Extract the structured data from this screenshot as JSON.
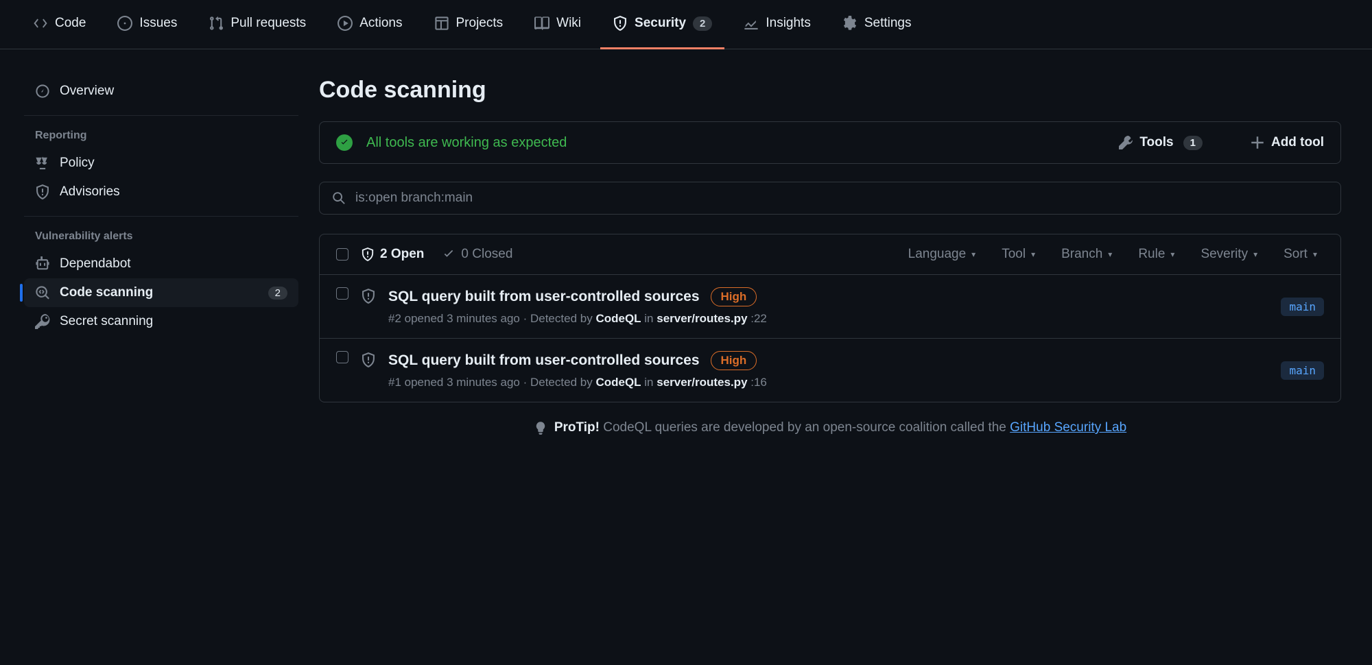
{
  "topnav": {
    "tabs": [
      {
        "label": "Code"
      },
      {
        "label": "Issues"
      },
      {
        "label": "Pull requests"
      },
      {
        "label": "Actions"
      },
      {
        "label": "Projects"
      },
      {
        "label": "Wiki"
      },
      {
        "label": "Security",
        "badge": "2",
        "active": true
      },
      {
        "label": "Insights"
      },
      {
        "label": "Settings"
      }
    ]
  },
  "sidebar": {
    "overview": "Overview",
    "section_reporting": "Reporting",
    "policy": "Policy",
    "advisories": "Advisories",
    "section_vuln": "Vulnerability alerts",
    "dependabot": "Dependabot",
    "code_scanning": "Code scanning",
    "code_scanning_count": "2",
    "secret_scanning": "Secret scanning"
  },
  "page": {
    "title": "Code scanning",
    "status_text": "All tools are working as expected",
    "tools_label": "Tools",
    "tools_count": "1",
    "add_tool": "Add tool"
  },
  "search": {
    "value": "is:open branch:main"
  },
  "listhead": {
    "open": "2 Open",
    "closed": "0 Closed",
    "filters": [
      "Language",
      "Tool",
      "Branch",
      "Rule",
      "Severity",
      "Sort"
    ]
  },
  "alerts": [
    {
      "title": "SQL query built from user-controlled sources",
      "severity": "High",
      "meta_prefix": "#2 opened 3 minutes ago · Detected by ",
      "detector": "CodeQL",
      "meta_mid": " in ",
      "file": "server/routes.py",
      "meta_suffix": " :22",
      "branch": "main"
    },
    {
      "title": "SQL query built from user-controlled sources",
      "severity": "High",
      "meta_prefix": "#1 opened 3 minutes ago · Detected by ",
      "detector": "CodeQL",
      "meta_mid": " in ",
      "file": "server/routes.py",
      "meta_suffix": " :16",
      "branch": "main"
    }
  ],
  "protip": {
    "label": "ProTip!",
    "text": " CodeQL queries are developed by an open-source coalition called the ",
    "link": "GitHub Security Lab"
  }
}
